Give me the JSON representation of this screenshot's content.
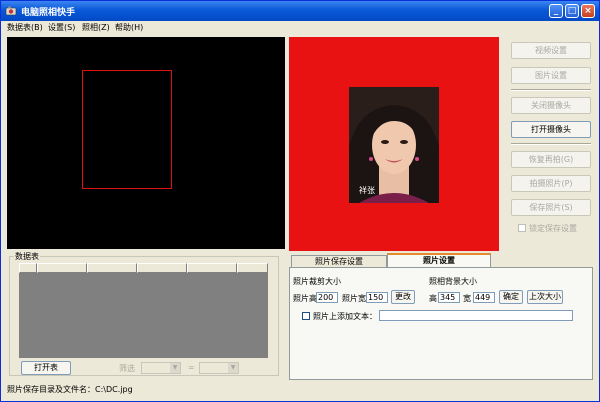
{
  "window": {
    "title": "电脑照相快手",
    "minimize": "_",
    "maximize": "□",
    "close": "×"
  },
  "menu": [
    "数据表(B)",
    "设置(S)",
    "照相(Z)",
    "帮助(H)"
  ],
  "photo": {
    "caption": "祥张"
  },
  "buttons": {
    "video_settings": "视频设置",
    "image_settings": "图片设置",
    "close_camera": "关闭摄像头",
    "open_camera": "打开摄像头",
    "restore_shoot": "恢复再拍(G)",
    "take_photo": "拍摄照片(P)",
    "save_photo": "保存照片(S)",
    "lock_save": "锁定保存设置"
  },
  "datatable": {
    "title": "数据表",
    "open_button": "打开表",
    "filter_label": "筛选",
    "equals": "="
  },
  "tabs": {
    "save_settings": "照片保存设置",
    "photo_settings": "照片设置"
  },
  "photo_settings": {
    "crop_size_label": "照片裁剪大小",
    "bg_size_label": "照相背景大小",
    "height_label": "照片高",
    "height_value": "200",
    "width_label": "照片宽",
    "width_value": "150",
    "change_button": "更改",
    "bg_height_label": "高",
    "bg_height_value": "345",
    "bg_width_label": "宽",
    "bg_width_value": "449",
    "ok_button": "确定",
    "last_size_button": "上次大小",
    "add_text_label": "照片上添加文本：",
    "add_text_value": ""
  },
  "status": {
    "text": "照片保存目录及文件名：C:\\DC.jpg"
  },
  "colors": {
    "title_bar": "#0a59d8",
    "photo_background": "#e81212",
    "crop_frame": "#dd1111"
  }
}
